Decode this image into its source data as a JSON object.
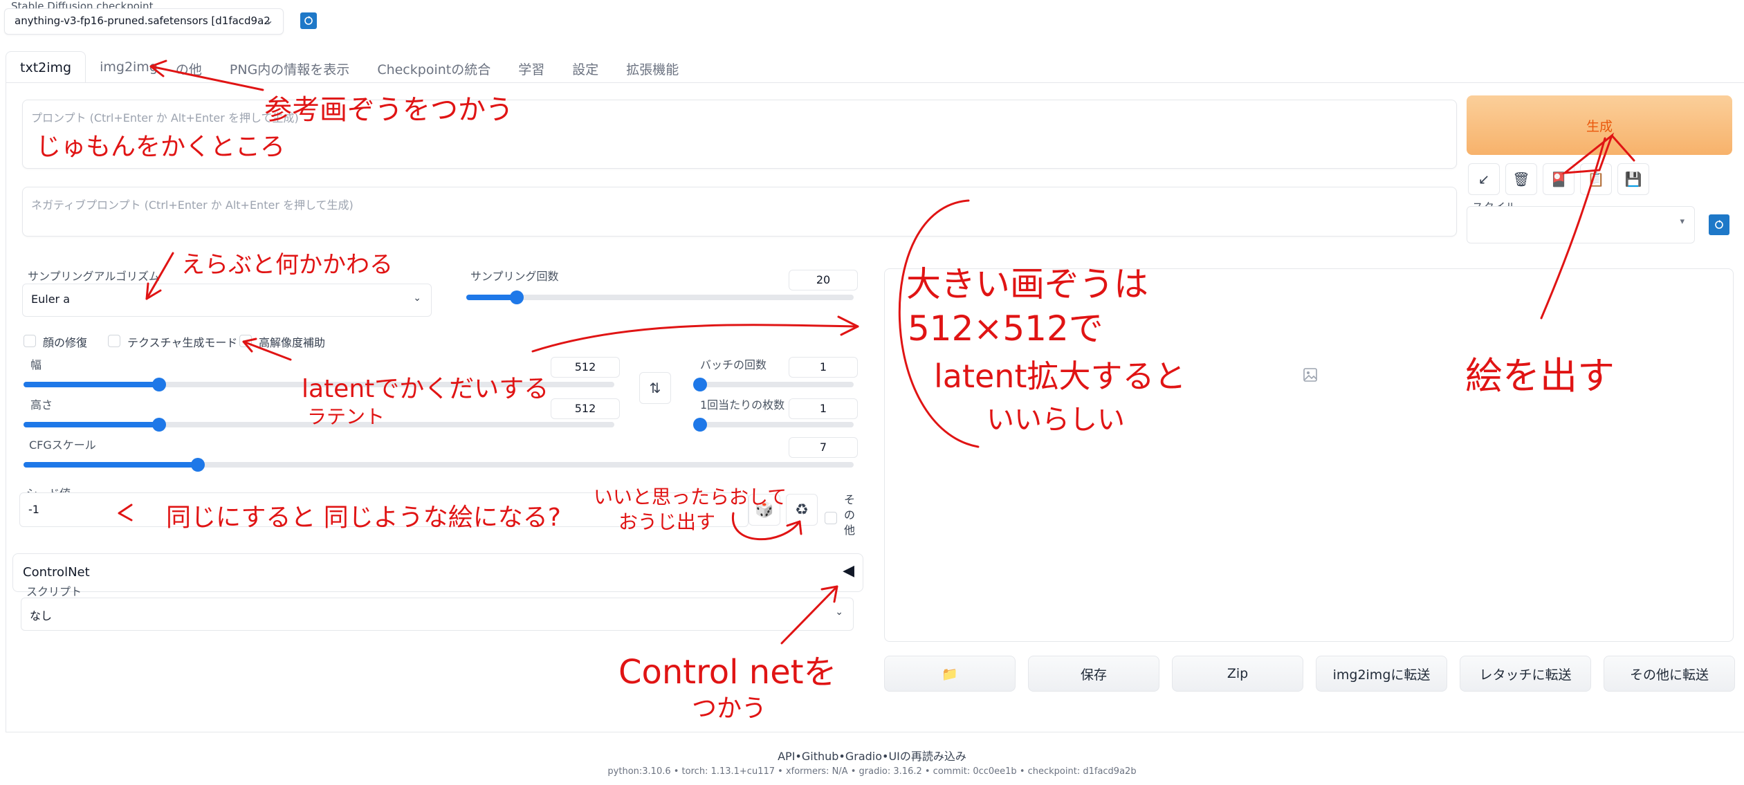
{
  "checkpoint": {
    "label": "Stable Diffusion checkpoint",
    "value": "anything-v3-fp16-pruned.safetensors [d1facd9a2"
  },
  "tabs": [
    {
      "label": "txt2img"
    },
    {
      "label": "img2img"
    },
    {
      "label": "の他"
    },
    {
      "label": "PNG内の情報を表示"
    },
    {
      "label": "Checkpointの統合"
    },
    {
      "label": "学習"
    },
    {
      "label": "設定"
    },
    {
      "label": "拡張機能"
    }
  ],
  "prompt": {
    "placeholder": "プロンプト (Ctrl+Enter か Alt+Enter を押して生成)"
  },
  "negative_prompt": {
    "placeholder": "ネガティブプロンプト (Ctrl+Enter か Alt+Enter を押して生成)"
  },
  "generate_label": "生成",
  "style": {
    "label": "スタイル"
  },
  "sampling": {
    "method_label": "サンプリングアルゴリズム",
    "method_value": "Euler a",
    "steps_label": "サンプリング回数",
    "steps_value": "20",
    "steps_fraction": 0.13
  },
  "checkboxes": [
    {
      "label": "顔の修復"
    },
    {
      "label": "テクスチャ生成モード"
    },
    {
      "label": "高解像度補助"
    }
  ],
  "width": {
    "label": "幅",
    "value": "512",
    "fraction": 0.23
  },
  "height": {
    "label": "高さ",
    "value": "512",
    "fraction": 0.23
  },
  "batch_count": {
    "label": "バッチの回数",
    "value": "1",
    "fraction": 0.0
  },
  "batch_size": {
    "label": "1回当たりの枚数",
    "value": "1",
    "fraction": 0.0
  },
  "cfg": {
    "label": "CFGスケール",
    "value": "7",
    "fraction": 0.21
  },
  "seed": {
    "label": "シード値",
    "value": "-1",
    "extra_label": "その他"
  },
  "controlnet": {
    "title": "ControlNet",
    "toggle": "◀"
  },
  "script": {
    "label": "スクリプト",
    "value": "なし"
  },
  "output_buttons": [
    {
      "label": ""
    },
    {
      "label": "保存"
    },
    {
      "label": "Zip"
    },
    {
      "label": "img2imgに転送"
    },
    {
      "label": "レタッチに転送"
    },
    {
      "label": "その他に転送"
    }
  ],
  "footer": {
    "links": "API•Github•Gradio•UIの再読み込み",
    "versions": "python:3.10.6 • torch: 1.13.1+cu117 • xformers: N/A • gradio: 3.16.2 • commit: 0cc0ee1b • checkpoint: d1facd9a2b"
  },
  "annotations": {
    "tab_note": "参考画ぞうをつかう",
    "prompt_note": "じゅもんをかくところ",
    "sampler_note": "えらぶと何かかわる",
    "hires_note_1": "latentでかくだいする",
    "hires_note_2": "ラテント",
    "size_note_1": "大きい画ぞうは",
    "size_note_2": "512×512で",
    "size_note_3": "latent拡大すると",
    "size_note_4": "いいらしい",
    "generate_note": "絵を出す",
    "seed_note": "同じにすると 同じような絵になる?",
    "recycle_note_1": "いいと思ったらおして",
    "recycle_note_2": "おうじ出す",
    "controlnet_note_1": "Control netを",
    "controlnet_note_2": "つかう"
  }
}
